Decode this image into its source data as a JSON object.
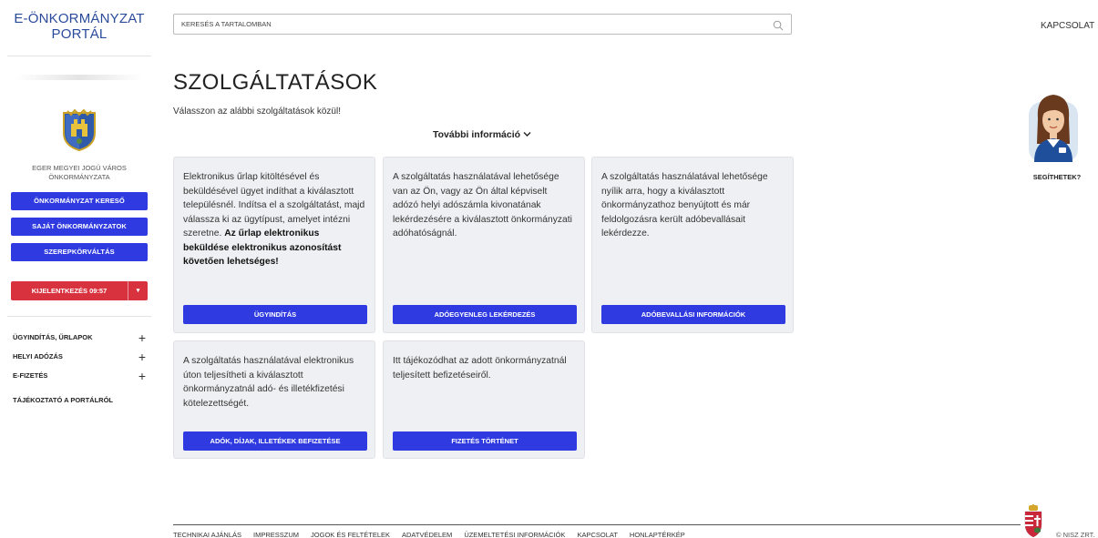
{
  "sidebar": {
    "logo_line1": "E-ÖNKORMÁNYZAT",
    "logo_line2": "PORTÁL",
    "municipality_line1": "EGER MEGYEI JOGÚ VÁROS",
    "municipality_line2": "ÖNKORMÁNYZATA",
    "buttons": [
      {
        "label": "ÖNKORMÁNYZAT KERESŐ"
      },
      {
        "label": "SAJÁT ÖNKORMÁNYZATOK"
      },
      {
        "label": "SZEREPKÖRVÁLTÁS"
      }
    ],
    "logout_label": "KIJELENTKEZÉS 09:57",
    "menu": [
      {
        "label": "ÜGYINDÍTÁS, ŰRLAPOK"
      },
      {
        "label": "HELYI ADÓZÁS"
      },
      {
        "label": "E-FIZETÉS"
      },
      {
        "label": "TÁJÉKOZTATÓ A PORTÁLRÓL"
      }
    ]
  },
  "header": {
    "search_placeholder": "KERESÉS A TARTALOMBAN",
    "contact_link": "KAPCSOLAT"
  },
  "main": {
    "title": "SZOLGÁLTATÁSOK",
    "subtitle": "Válasszon az alábbi szolgáltatások közül!",
    "more_info": "További információ",
    "cards": [
      {
        "text": "Elektronikus űrlap kitöltésével és beküldésével ügyet indíthat a kiválasztott településnél. Indítsa el a szolgáltatást, majd válassza ki az ügytípust, amelyet intézni szeretne.",
        "bold_text": "Az űrlap elektronikus beküldése elektronikus azonosítást követően lehetséges!",
        "button": "ÜGYINDÍTÁS"
      },
      {
        "text": "A szolgáltatás használatával lehetősége van az Ön, vagy az Ön által képviselt adózó helyi adószámla kivonatának lekérdezésére a kiválasztott önkormányzati adóhatóságnál.",
        "button": "ADÓEGYENLEG LEKÉRDEZÉS"
      },
      {
        "text": "A szolgáltatás használatával lehetősége nyílik arra, hogy a kiválasztott önkormányzathoz benyújtott és már feldolgozásra került adóbevallásait lekérdezze.",
        "button": "ADÓBEVALLÁSI INFORMÁCIÓK"
      },
      {
        "text": "A szolgáltatás használatával elektronikus úton teljesítheti a kiválasztott önkormányzatnál adó- és illetékfizetési kötelezettségét.",
        "button": "ADÓK, DÍJAK, ILLETÉKEK BEFIZETÉSE"
      },
      {
        "text": "Itt tájékozódhat az adott önkormányzatnál teljesített befizetéseiről.",
        "button": "FIZETÉS TÖRTÉNET"
      }
    ]
  },
  "assistant": {
    "label": "SEGÍTHETEK?"
  },
  "footer": {
    "links": [
      "TECHNIKAI AJÁNLÁS",
      "IMPRESSZUM",
      "JOGOK ÉS FELTÉTELEK",
      "ADATVÉDELEM",
      "ÜZEMELTETÉSI INFORMÁCIÓK",
      "KAPCSOLAT",
      "HONLAPTÉRKÉP"
    ],
    "copyright": "© NISZ ZRT."
  },
  "colors": {
    "brand_blue": "#2f3be0",
    "logout_red": "#d8323e",
    "logo_blue": "#2a4a9a",
    "card_bg": "#eef0f3"
  },
  "icons": [
    "search-icon",
    "chevron-down-icon",
    "plus-icon",
    "municipal-crest-icon",
    "assistant-avatar-icon",
    "hungary-coat-of-arms-icon"
  ]
}
